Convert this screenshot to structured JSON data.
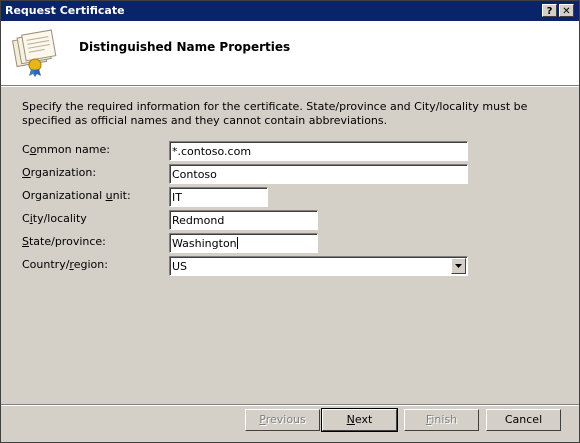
{
  "window": {
    "title": "Request Certificate",
    "help_glyph": "?",
    "close_glyph": "✕"
  },
  "header": {
    "title": "Distinguished Name Properties",
    "icon": "certificate-icon"
  },
  "description": "Specify the required information for the certificate. State/province and City/locality must be specified as official names and they cannot contain abbreviations.",
  "fields": {
    "common_name": {
      "label_pre": "C",
      "label_u": "o",
      "label_post": "mmon name:",
      "value": "*.contoso.com"
    },
    "organization": {
      "label_pre": "",
      "label_u": "O",
      "label_post": "rganization:",
      "value": "Contoso"
    },
    "org_unit": {
      "label_pre": "Organizational ",
      "label_u": "u",
      "label_post": "nit:",
      "value": "IT"
    },
    "city": {
      "label_pre": "C",
      "label_u": "i",
      "label_post": "ty/locality",
      "value": "Redmond"
    },
    "state": {
      "label_pre": "",
      "label_u": "S",
      "label_post": "tate/province:",
      "value": "Washington"
    },
    "country": {
      "label_pre": "Country/",
      "label_u": "r",
      "label_post": "egion:",
      "value": "US"
    }
  },
  "buttons": {
    "previous": {
      "pre": "",
      "u": "P",
      "post": "revious"
    },
    "next": {
      "pre": "",
      "u": "N",
      "post": "ext"
    },
    "finish": {
      "pre": "",
      "u": "F",
      "post": "inish"
    },
    "cancel": "Cancel"
  }
}
